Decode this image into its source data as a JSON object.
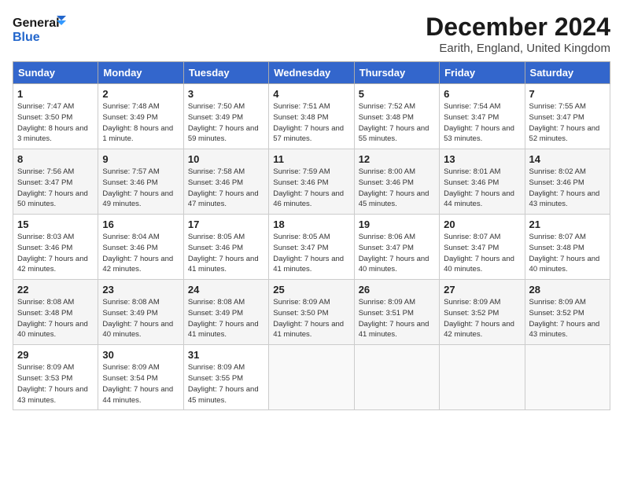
{
  "header": {
    "logo_general": "General",
    "logo_blue": "Blue",
    "month_title": "December 2024",
    "subtitle": "Earith, England, United Kingdom"
  },
  "days_of_week": [
    "Sunday",
    "Monday",
    "Tuesday",
    "Wednesday",
    "Thursday",
    "Friday",
    "Saturday"
  ],
  "weeks": [
    [
      {
        "day": 1,
        "sunrise": "7:47 AM",
        "sunset": "3:50 PM",
        "daylight": "8 hours and 3 minutes."
      },
      {
        "day": 2,
        "sunrise": "7:48 AM",
        "sunset": "3:49 PM",
        "daylight": "8 hours and 1 minute."
      },
      {
        "day": 3,
        "sunrise": "7:50 AM",
        "sunset": "3:49 PM",
        "daylight": "7 hours and 59 minutes."
      },
      {
        "day": 4,
        "sunrise": "7:51 AM",
        "sunset": "3:48 PM",
        "daylight": "7 hours and 57 minutes."
      },
      {
        "day": 5,
        "sunrise": "7:52 AM",
        "sunset": "3:48 PM",
        "daylight": "7 hours and 55 minutes."
      },
      {
        "day": 6,
        "sunrise": "7:54 AM",
        "sunset": "3:47 PM",
        "daylight": "7 hours and 53 minutes."
      },
      {
        "day": 7,
        "sunrise": "7:55 AM",
        "sunset": "3:47 PM",
        "daylight": "7 hours and 52 minutes."
      }
    ],
    [
      {
        "day": 8,
        "sunrise": "7:56 AM",
        "sunset": "3:47 PM",
        "daylight": "7 hours and 50 minutes."
      },
      {
        "day": 9,
        "sunrise": "7:57 AM",
        "sunset": "3:46 PM",
        "daylight": "7 hours and 49 minutes."
      },
      {
        "day": 10,
        "sunrise": "7:58 AM",
        "sunset": "3:46 PM",
        "daylight": "7 hours and 47 minutes."
      },
      {
        "day": 11,
        "sunrise": "7:59 AM",
        "sunset": "3:46 PM",
        "daylight": "7 hours and 46 minutes."
      },
      {
        "day": 12,
        "sunrise": "8:00 AM",
        "sunset": "3:46 PM",
        "daylight": "7 hours and 45 minutes."
      },
      {
        "day": 13,
        "sunrise": "8:01 AM",
        "sunset": "3:46 PM",
        "daylight": "7 hours and 44 minutes."
      },
      {
        "day": 14,
        "sunrise": "8:02 AM",
        "sunset": "3:46 PM",
        "daylight": "7 hours and 43 minutes."
      }
    ],
    [
      {
        "day": 15,
        "sunrise": "8:03 AM",
        "sunset": "3:46 PM",
        "daylight": "7 hours and 42 minutes."
      },
      {
        "day": 16,
        "sunrise": "8:04 AM",
        "sunset": "3:46 PM",
        "daylight": "7 hours and 42 minutes."
      },
      {
        "day": 17,
        "sunrise": "8:05 AM",
        "sunset": "3:46 PM",
        "daylight": "7 hours and 41 minutes."
      },
      {
        "day": 18,
        "sunrise": "8:05 AM",
        "sunset": "3:47 PM",
        "daylight": "7 hours and 41 minutes."
      },
      {
        "day": 19,
        "sunrise": "8:06 AM",
        "sunset": "3:47 PM",
        "daylight": "7 hours and 40 minutes."
      },
      {
        "day": 20,
        "sunrise": "8:07 AM",
        "sunset": "3:47 PM",
        "daylight": "7 hours and 40 minutes."
      },
      {
        "day": 21,
        "sunrise": "8:07 AM",
        "sunset": "3:48 PM",
        "daylight": "7 hours and 40 minutes."
      }
    ],
    [
      {
        "day": 22,
        "sunrise": "8:08 AM",
        "sunset": "3:48 PM",
        "daylight": "7 hours and 40 minutes."
      },
      {
        "day": 23,
        "sunrise": "8:08 AM",
        "sunset": "3:49 PM",
        "daylight": "7 hours and 40 minutes."
      },
      {
        "day": 24,
        "sunrise": "8:08 AM",
        "sunset": "3:49 PM",
        "daylight": "7 hours and 41 minutes."
      },
      {
        "day": 25,
        "sunrise": "8:09 AM",
        "sunset": "3:50 PM",
        "daylight": "7 hours and 41 minutes."
      },
      {
        "day": 26,
        "sunrise": "8:09 AM",
        "sunset": "3:51 PM",
        "daylight": "7 hours and 41 minutes."
      },
      {
        "day": 27,
        "sunrise": "8:09 AM",
        "sunset": "3:52 PM",
        "daylight": "7 hours and 42 minutes."
      },
      {
        "day": 28,
        "sunrise": "8:09 AM",
        "sunset": "3:52 PM",
        "daylight": "7 hours and 43 minutes."
      }
    ],
    [
      {
        "day": 29,
        "sunrise": "8:09 AM",
        "sunset": "3:53 PM",
        "daylight": "7 hours and 43 minutes."
      },
      {
        "day": 30,
        "sunrise": "8:09 AM",
        "sunset": "3:54 PM",
        "daylight": "7 hours and 44 minutes."
      },
      {
        "day": 31,
        "sunrise": "8:09 AM",
        "sunset": "3:55 PM",
        "daylight": "7 hours and 45 minutes."
      },
      null,
      null,
      null,
      null
    ]
  ]
}
